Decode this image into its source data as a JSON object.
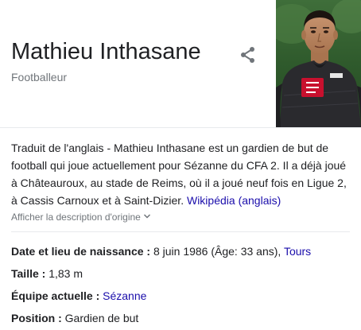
{
  "header": {
    "title": "Mathieu Inthasane",
    "subtitle": "Footballeur",
    "share_icon": "share-icon"
  },
  "colors": {
    "link": "#1a0dab",
    "muted": "#70757a",
    "text": "#202124",
    "divider": "#e8eaed",
    "jersey": "#2a2a2e",
    "badge_red": "#c8102e"
  },
  "description": {
    "text": "Traduit de l'anglais - Mathieu Inthasane est un gardien de but de football qui joue actuellement pour Sézanne du CFA 2. Il a déjà joué à Châteauroux, au stade de Reims, où il a joué neuf fois en Ligue 2, à Cassis Carnoux et à Saint-Dizier. ",
    "link": "Wikipédia (anglais)"
  },
  "original_toggle": {
    "label": "Afficher la description d'origine"
  },
  "facts": {
    "birth": {
      "label": "Date et lieu de naissance :",
      "value": " 8 juin 1986 (Âge: 33 ans), ",
      "link": "Tours"
    },
    "height": {
      "label": "Taille :",
      "value": " 1,83 m"
    },
    "team": {
      "label": "Équipe actuelle :",
      "link": "Sézanne"
    },
    "position": {
      "label": "Position :",
      "value": " Gardien de but"
    }
  }
}
